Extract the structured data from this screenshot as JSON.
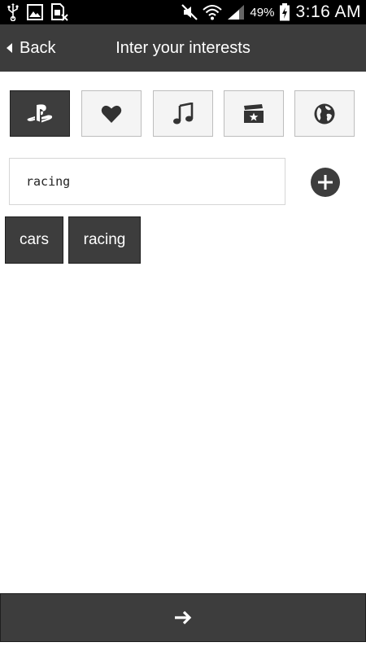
{
  "status_bar": {
    "battery_percent": "49%",
    "time": "3:16 AM",
    "icons": [
      "usb-icon",
      "image-icon",
      "sim-card-icon",
      "mute-icon",
      "wifi-icon",
      "signal-icon",
      "battery-charging-icon"
    ]
  },
  "header": {
    "back_label": "Back",
    "title": "Inter your interests"
  },
  "categories": [
    {
      "icon": "playstation-icon",
      "active": true
    },
    {
      "icon": "heart-icon",
      "active": false
    },
    {
      "icon": "music-note-icon",
      "active": false
    },
    {
      "icon": "movie-clapper-icon",
      "active": false
    },
    {
      "icon": "globe-icon",
      "active": false
    }
  ],
  "interest_input": {
    "value": "racing"
  },
  "tags": [
    {
      "label": "cars"
    },
    {
      "label": "racing"
    }
  ],
  "next_button": {
    "icon": "arrow-right-icon"
  },
  "colors": {
    "dark": "#3d3d3d",
    "header": "#3c3c3c",
    "status_bar": "#000000",
    "button_light": "#f4f4f4"
  }
}
